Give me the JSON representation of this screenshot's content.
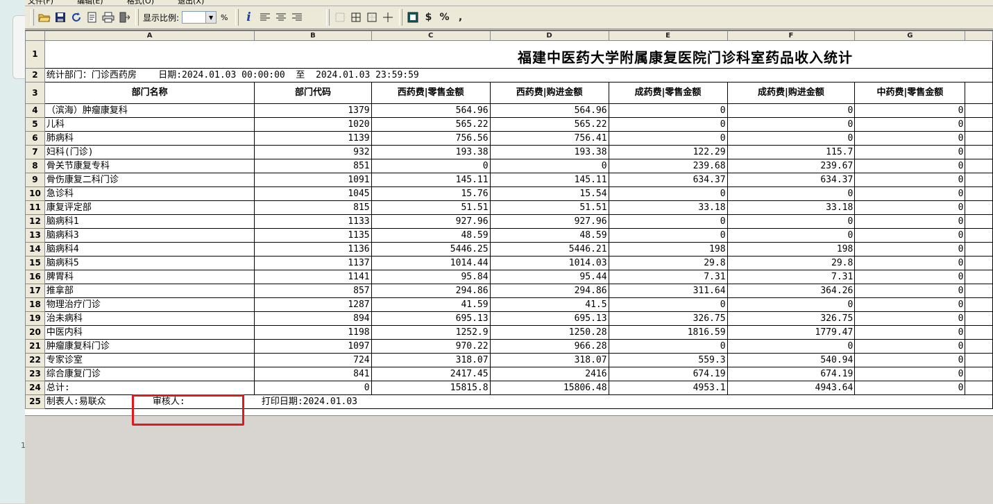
{
  "menu": [
    "文件(F)",
    "编辑(E)",
    "格式(O)",
    "退出(X)"
  ],
  "toolbar": {
    "zoom_label": "显示比例:",
    "zoom_value": "",
    "percent": "%",
    "currency": "$",
    "percent_btn": "%",
    "comma_btn": ","
  },
  "columns": [
    "A",
    "B",
    "C",
    "D",
    "E",
    "F",
    "G"
  ],
  "report": {
    "title": "福建中医药大学附属康复医院门诊科室药品收入统计",
    "info": "统计部门：门诊西药房    日期:2024.01.03 00:00:00  至  2024.01.03 23:59:59",
    "headers": [
      "部门名称",
      "部门代码",
      "西药费|零售金额",
      "西药费|购进金额",
      "成药费|零售金额",
      "成药费|购进金额",
      "中药费|零售金额"
    ],
    "rows": [
      {
        "n": "4",
        "name": "（滨海）肿瘤康复科",
        "code": "1379",
        "c": "564.96",
        "d": "564.96",
        "e": "0",
        "f": "0",
        "g": "0"
      },
      {
        "n": "5",
        "name": "儿科",
        "code": "1020",
        "c": "565.22",
        "d": "565.22",
        "e": "0",
        "f": "0",
        "g": "0"
      },
      {
        "n": "6",
        "name": "肺病科",
        "code": "1139",
        "c": "756.56",
        "d": "756.41",
        "e": "0",
        "f": "0",
        "g": "0"
      },
      {
        "n": "7",
        "name": "妇科(门诊)",
        "code": "932",
        "c": "193.38",
        "d": "193.38",
        "e": "122.29",
        "f": "115.7",
        "g": "0"
      },
      {
        "n": "8",
        "name": "骨关节康复专科",
        "code": "851",
        "c": "0",
        "d": "0",
        "e": "239.68",
        "f": "239.67",
        "g": "0"
      },
      {
        "n": "9",
        "name": "骨伤康复二科门诊",
        "code": "1091",
        "c": "145.11",
        "d": "145.11",
        "e": "634.37",
        "f": "634.37",
        "g": "0"
      },
      {
        "n": "10",
        "name": "急诊科",
        "code": "1045",
        "c": "15.76",
        "d": "15.54",
        "e": "0",
        "f": "0",
        "g": "0"
      },
      {
        "n": "11",
        "name": "康复评定部",
        "code": "815",
        "c": "51.51",
        "d": "51.51",
        "e": "33.18",
        "f": "33.18",
        "g": "0"
      },
      {
        "n": "12",
        "name": "脑病科1",
        "code": "1133",
        "c": "927.96",
        "d": "927.96",
        "e": "0",
        "f": "0",
        "g": "0"
      },
      {
        "n": "13",
        "name": "脑病科3",
        "code": "1135",
        "c": "48.59",
        "d": "48.59",
        "e": "0",
        "f": "0",
        "g": "0"
      },
      {
        "n": "14",
        "name": "脑病科4",
        "code": "1136",
        "c": "5446.25",
        "d": "5446.21",
        "e": "198",
        "f": "198",
        "g": "0"
      },
      {
        "n": "15",
        "name": "脑病科5",
        "code": "1137",
        "c": "1014.44",
        "d": "1014.03",
        "e": "29.8",
        "f": "29.8",
        "g": "0"
      },
      {
        "n": "16",
        "name": "脾胃科",
        "code": "1141",
        "c": "95.84",
        "d": "95.44",
        "e": "7.31",
        "f": "7.31",
        "g": "0"
      },
      {
        "n": "17",
        "name": "推拿部",
        "code": "857",
        "c": "294.86",
        "d": "294.86",
        "e": "311.64",
        "f": "364.26",
        "g": "0"
      },
      {
        "n": "18",
        "name": "物理治疗门诊",
        "code": "1287",
        "c": "41.59",
        "d": "41.5",
        "e": "0",
        "f": "0",
        "g": "0"
      },
      {
        "n": "19",
        "name": "治未病科",
        "code": "894",
        "c": "695.13",
        "d": "695.13",
        "e": "326.75",
        "f": "326.75",
        "g": "0"
      },
      {
        "n": "20",
        "name": "中医内科",
        "code": "1198",
        "c": "1252.9",
        "d": "1250.28",
        "e": "1816.59",
        "f": "1779.47",
        "g": "0"
      },
      {
        "n": "21",
        "name": "肿瘤康复科门诊",
        "code": "1097",
        "c": "970.22",
        "d": "966.28",
        "e": "0",
        "f": "0",
        "g": "0"
      },
      {
        "n": "22",
        "name": "专家诊室",
        "code": "724",
        "c": "318.07",
        "d": "318.07",
        "e": "559.3",
        "f": "540.94",
        "g": "0"
      },
      {
        "n": "23",
        "name": "综合康复门诊",
        "code": "841",
        "c": "2417.45",
        "d": "2416",
        "e": "674.19",
        "f": "674.19",
        "g": "0"
      },
      {
        "n": "24",
        "name": "总计:",
        "code": "0",
        "c": "15815.8",
        "d": "15806.48",
        "e": "4953.1",
        "f": "4943.64",
        "g": "0"
      }
    ],
    "footer": {
      "maker": "制表人:易联众",
      "reviewer": "审核人:",
      "print_date": "打印日期:2024.01.03"
    }
  },
  "left_mark": "1"
}
